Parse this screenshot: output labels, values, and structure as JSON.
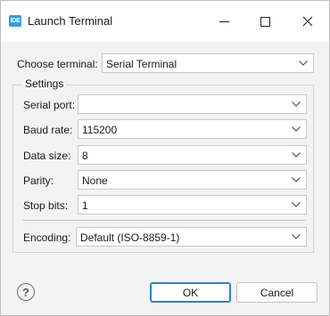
{
  "window": {
    "app_icon_text": "IDE",
    "title": "Launch Terminal"
  },
  "choose_terminal": {
    "label": "Choose terminal:",
    "value": "Serial Terminal"
  },
  "settings": {
    "group_title": "Settings",
    "serial_port": {
      "label": "Serial port:",
      "value": ""
    },
    "baud_rate": {
      "label": "Baud rate:",
      "value": "115200"
    },
    "data_size": {
      "label": "Data size:",
      "value": "8"
    },
    "parity": {
      "label": "Parity:",
      "value": "None"
    },
    "stop_bits": {
      "label": "Stop bits:",
      "value": "1"
    },
    "encoding": {
      "label": "Encoding:",
      "value": "Default (ISO-8859-1)"
    }
  },
  "footer": {
    "help_glyph": "?",
    "ok_label": "OK",
    "cancel_label": "Cancel"
  },
  "colors": {
    "accent": "#2f7fd4",
    "app_icon": "#2f9ee6"
  },
  "icons": [
    "ide-app-icon",
    "minimize-icon",
    "maximize-icon",
    "close-icon",
    "chevron-down-icon",
    "help-icon"
  ]
}
